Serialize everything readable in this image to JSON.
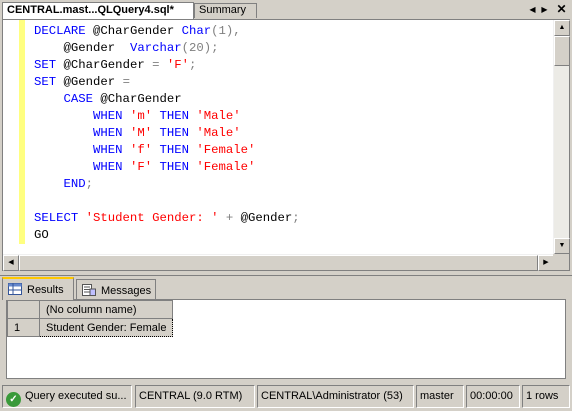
{
  "doc_tabs": {
    "active_label": "CENTRAL.mast...QLQuery4.sql*",
    "inactive_label": "Summary",
    "close_glyph": "✕",
    "prev_glyph": "◀",
    "next_glyph": "▶"
  },
  "editor": {
    "lines": [
      [
        {
          "t": "DECLARE ",
          "c": "kw"
        },
        {
          "t": "@CharGender ",
          "c": "var"
        },
        {
          "t": "Char",
          "c": "kw"
        },
        {
          "t": "(1)",
          "c": "op"
        },
        {
          "t": ",",
          "c": "op"
        }
      ],
      [
        {
          "t": "    @Gender  ",
          "c": "var"
        },
        {
          "t": "Varchar",
          "c": "kw"
        },
        {
          "t": "(20)",
          "c": "op"
        },
        {
          "t": ";",
          "c": "op"
        }
      ],
      [
        {
          "t": "SET ",
          "c": "kw"
        },
        {
          "t": "@CharGender ",
          "c": "var"
        },
        {
          "t": "= ",
          "c": "op"
        },
        {
          "t": "'F'",
          "c": "str"
        },
        {
          "t": ";",
          "c": "op"
        }
      ],
      [
        {
          "t": "SET ",
          "c": "kw"
        },
        {
          "t": "@Gender ",
          "c": "var"
        },
        {
          "t": "=",
          "c": "op"
        }
      ],
      [
        {
          "t": "    CASE ",
          "c": "kw"
        },
        {
          "t": "@CharGender",
          "c": "var"
        }
      ],
      [
        {
          "t": "        WHEN ",
          "c": "kw"
        },
        {
          "t": "'m' ",
          "c": "str"
        },
        {
          "t": "THEN ",
          "c": "kw"
        },
        {
          "t": "'Male'",
          "c": "str"
        }
      ],
      [
        {
          "t": "        WHEN ",
          "c": "kw"
        },
        {
          "t": "'M' ",
          "c": "str"
        },
        {
          "t": "THEN ",
          "c": "kw"
        },
        {
          "t": "'Male'",
          "c": "str"
        }
      ],
      [
        {
          "t": "        WHEN ",
          "c": "kw"
        },
        {
          "t": "'f' ",
          "c": "str"
        },
        {
          "t": "THEN ",
          "c": "kw"
        },
        {
          "t": "'Female'",
          "c": "str"
        }
      ],
      [
        {
          "t": "        WHEN ",
          "c": "kw"
        },
        {
          "t": "'F' ",
          "c": "str"
        },
        {
          "t": "THEN ",
          "c": "kw"
        },
        {
          "t": "'Female'",
          "c": "str"
        }
      ],
      [
        {
          "t": "    END",
          "c": "kw"
        },
        {
          "t": ";",
          "c": "op"
        }
      ],
      [],
      [
        {
          "t": "SELECT ",
          "c": "kw"
        },
        {
          "t": "'Student Gender: ' ",
          "c": "str"
        },
        {
          "t": "+ ",
          "c": "op"
        },
        {
          "t": "@Gender",
          "c": "var"
        },
        {
          "t": ";",
          "c": "op"
        }
      ],
      [
        {
          "t": "GO",
          "c": "var"
        }
      ]
    ]
  },
  "results_tabs": {
    "results_label": "Results",
    "messages_label": "Messages"
  },
  "results_grid": {
    "columns": [
      "(No column name)"
    ],
    "rows": [
      {
        "num": "1",
        "cells": [
          "Student Gender: Female"
        ]
      }
    ]
  },
  "status_bar": {
    "message": "Query executed su...",
    "server": "CENTRAL (9.0 RTM)",
    "user": "CENTRAL\\Administrator (53)",
    "database": "master",
    "elapsed": "00:00:00",
    "rows": "1 rows"
  },
  "colors": {
    "keyword": "#0000ff",
    "string": "#ff0000",
    "operator": "#808080",
    "gutter": "#ffff80",
    "success": "#3a9a3a"
  }
}
